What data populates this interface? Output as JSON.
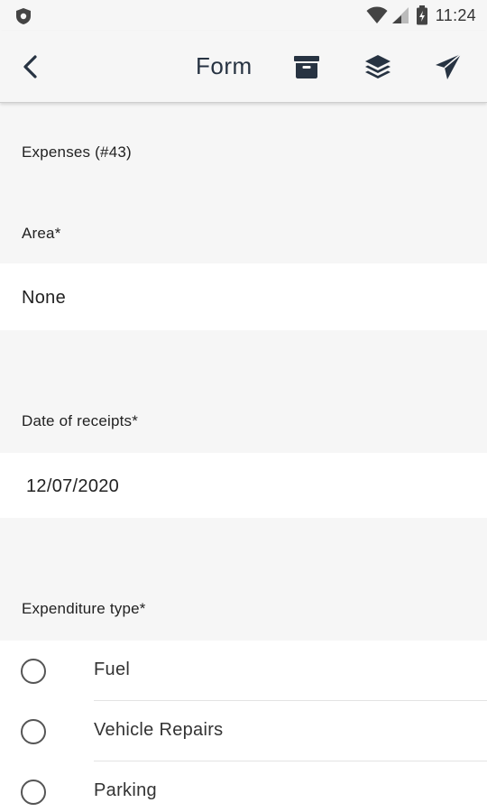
{
  "status_bar": {
    "time": "11:24",
    "icons": [
      "shield-icon",
      "wifi-icon",
      "signal-icon",
      "battery-icon"
    ]
  },
  "app_bar": {
    "title": "Form",
    "actions": [
      "back-arrow-icon",
      "archive-icon",
      "layers-icon",
      "send-icon"
    ]
  },
  "form": {
    "heading": "Expenses (#43)",
    "area": {
      "label": "Area*",
      "value": "None"
    },
    "date_of_receipts": {
      "label": "Date of receipts*",
      "value": "12/07/2020"
    },
    "expenditure_type": {
      "label": "Expenditure type*",
      "options": [
        {
          "label": "Fuel",
          "selected": false
        },
        {
          "label": "Vehicle Repairs",
          "selected": false
        },
        {
          "label": "Parking",
          "selected": false
        }
      ]
    }
  },
  "colors": {
    "background": "#f6f6f6",
    "field_background": "#ffffff",
    "toolbar_icon": "#273342"
  }
}
